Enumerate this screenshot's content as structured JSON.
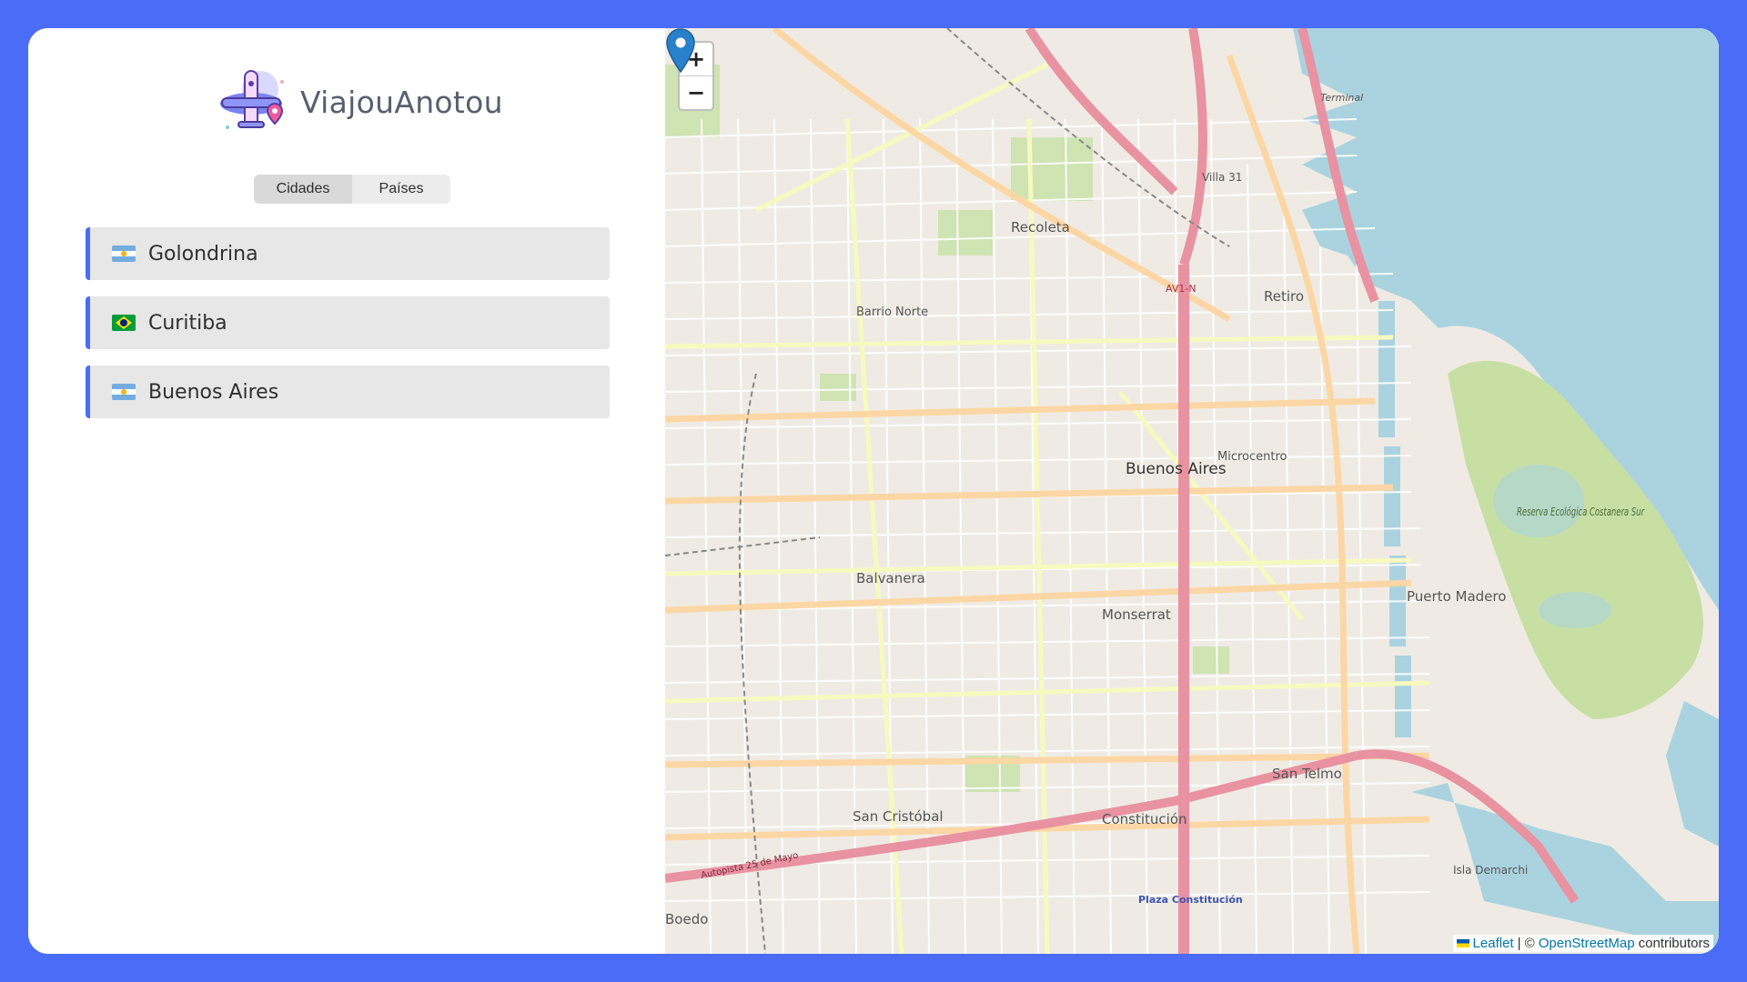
{
  "app": {
    "name": "ViajouAnotou"
  },
  "tabs": [
    {
      "label": "Cidades",
      "active": true
    },
    {
      "label": "Países",
      "active": false
    }
  ],
  "cities": [
    {
      "name": "Golondrina",
      "flag": "argentina-flag"
    },
    {
      "name": "Curitiba",
      "flag": "brazil-flag"
    },
    {
      "name": "Buenos Aires",
      "flag": "argentina-flag"
    }
  ],
  "map": {
    "zoom_in": "+",
    "zoom_out": "−",
    "labels": {
      "recoleta": "Recoleta",
      "barrio_norte": "Barrio Norte",
      "retiro": "Retiro",
      "buenos_aires": "Buenos Aires",
      "microcentro": "Microcentro",
      "balvanera": "Balvanera",
      "monserrat": "Monserrat",
      "puerto_madero": "Puerto Madero",
      "san_telmo": "San Telmo",
      "san_cristobal": "San Cristóbal",
      "constitucion": "Constitución",
      "boedo": "Boedo",
      "reserva": "Reserva Ecológica Costanera Sur",
      "isla_demarchi": "Isla Demarchi",
      "villa31": "Villa 31",
      "terminal": "Terminal",
      "autopista": "Autopista 25 de Mayo",
      "av1n": "AV1-N",
      "plaza_constitucion": "Plaza Constitución"
    },
    "attribution": {
      "leaflet": "Leaflet",
      "separator": " | © ",
      "osm": "OpenStreetMap",
      "suffix": " contributors"
    }
  },
  "colors": {
    "accent": "#4a6cf7",
    "water": "#aad3df",
    "park": "#c8dfa4",
    "highway": "#e892a2",
    "primary_road": "#fcd6a4",
    "marker": "#2a81cb"
  }
}
